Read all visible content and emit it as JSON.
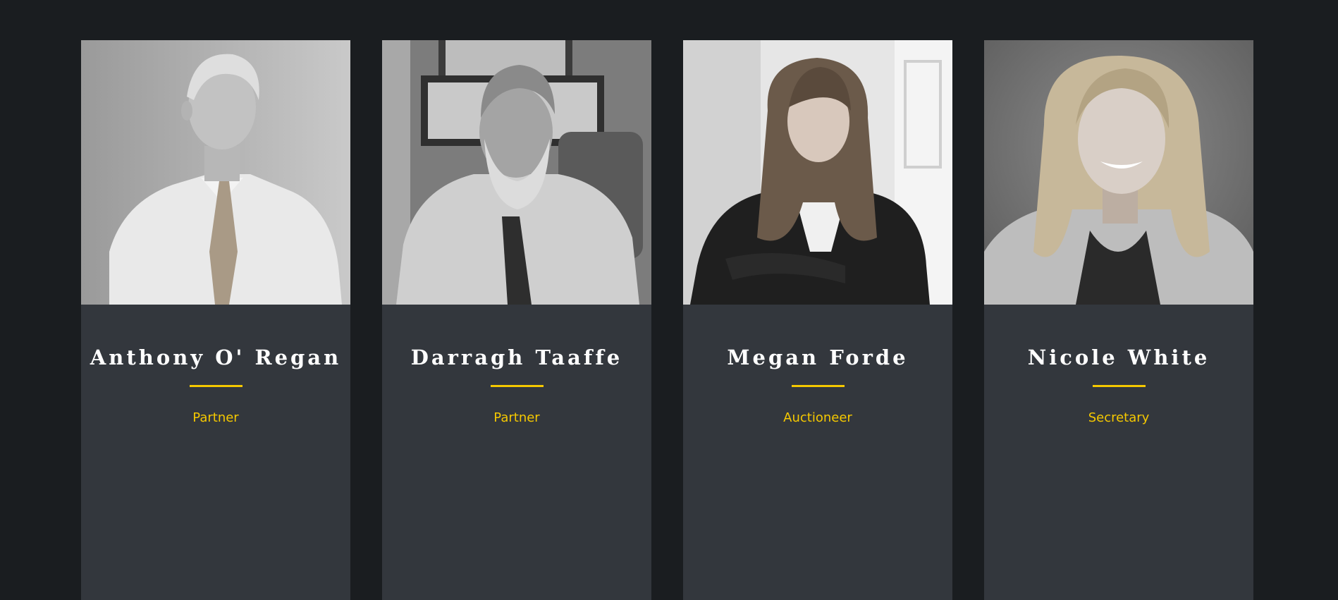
{
  "colors": {
    "page_background": "#1a1d20",
    "card_background": "#33373d",
    "accent": "#f5c800",
    "name_text": "#ffffff"
  },
  "team": [
    {
      "name": "Anthony O' Regan",
      "role": "Partner",
      "photo": "portrait-photo-man-grey-hair-tie"
    },
    {
      "name": "Darragh Taaffe",
      "role": "Partner",
      "photo": "portrait-photo-man-beard-tie"
    },
    {
      "name": "Megan Forde",
      "role": "Auctioneer",
      "photo": "portrait-photo-woman-dark-blazer"
    },
    {
      "name": "Nicole White",
      "role": "Secretary",
      "photo": "portrait-photo-woman-long-blonde-hair"
    }
  ]
}
